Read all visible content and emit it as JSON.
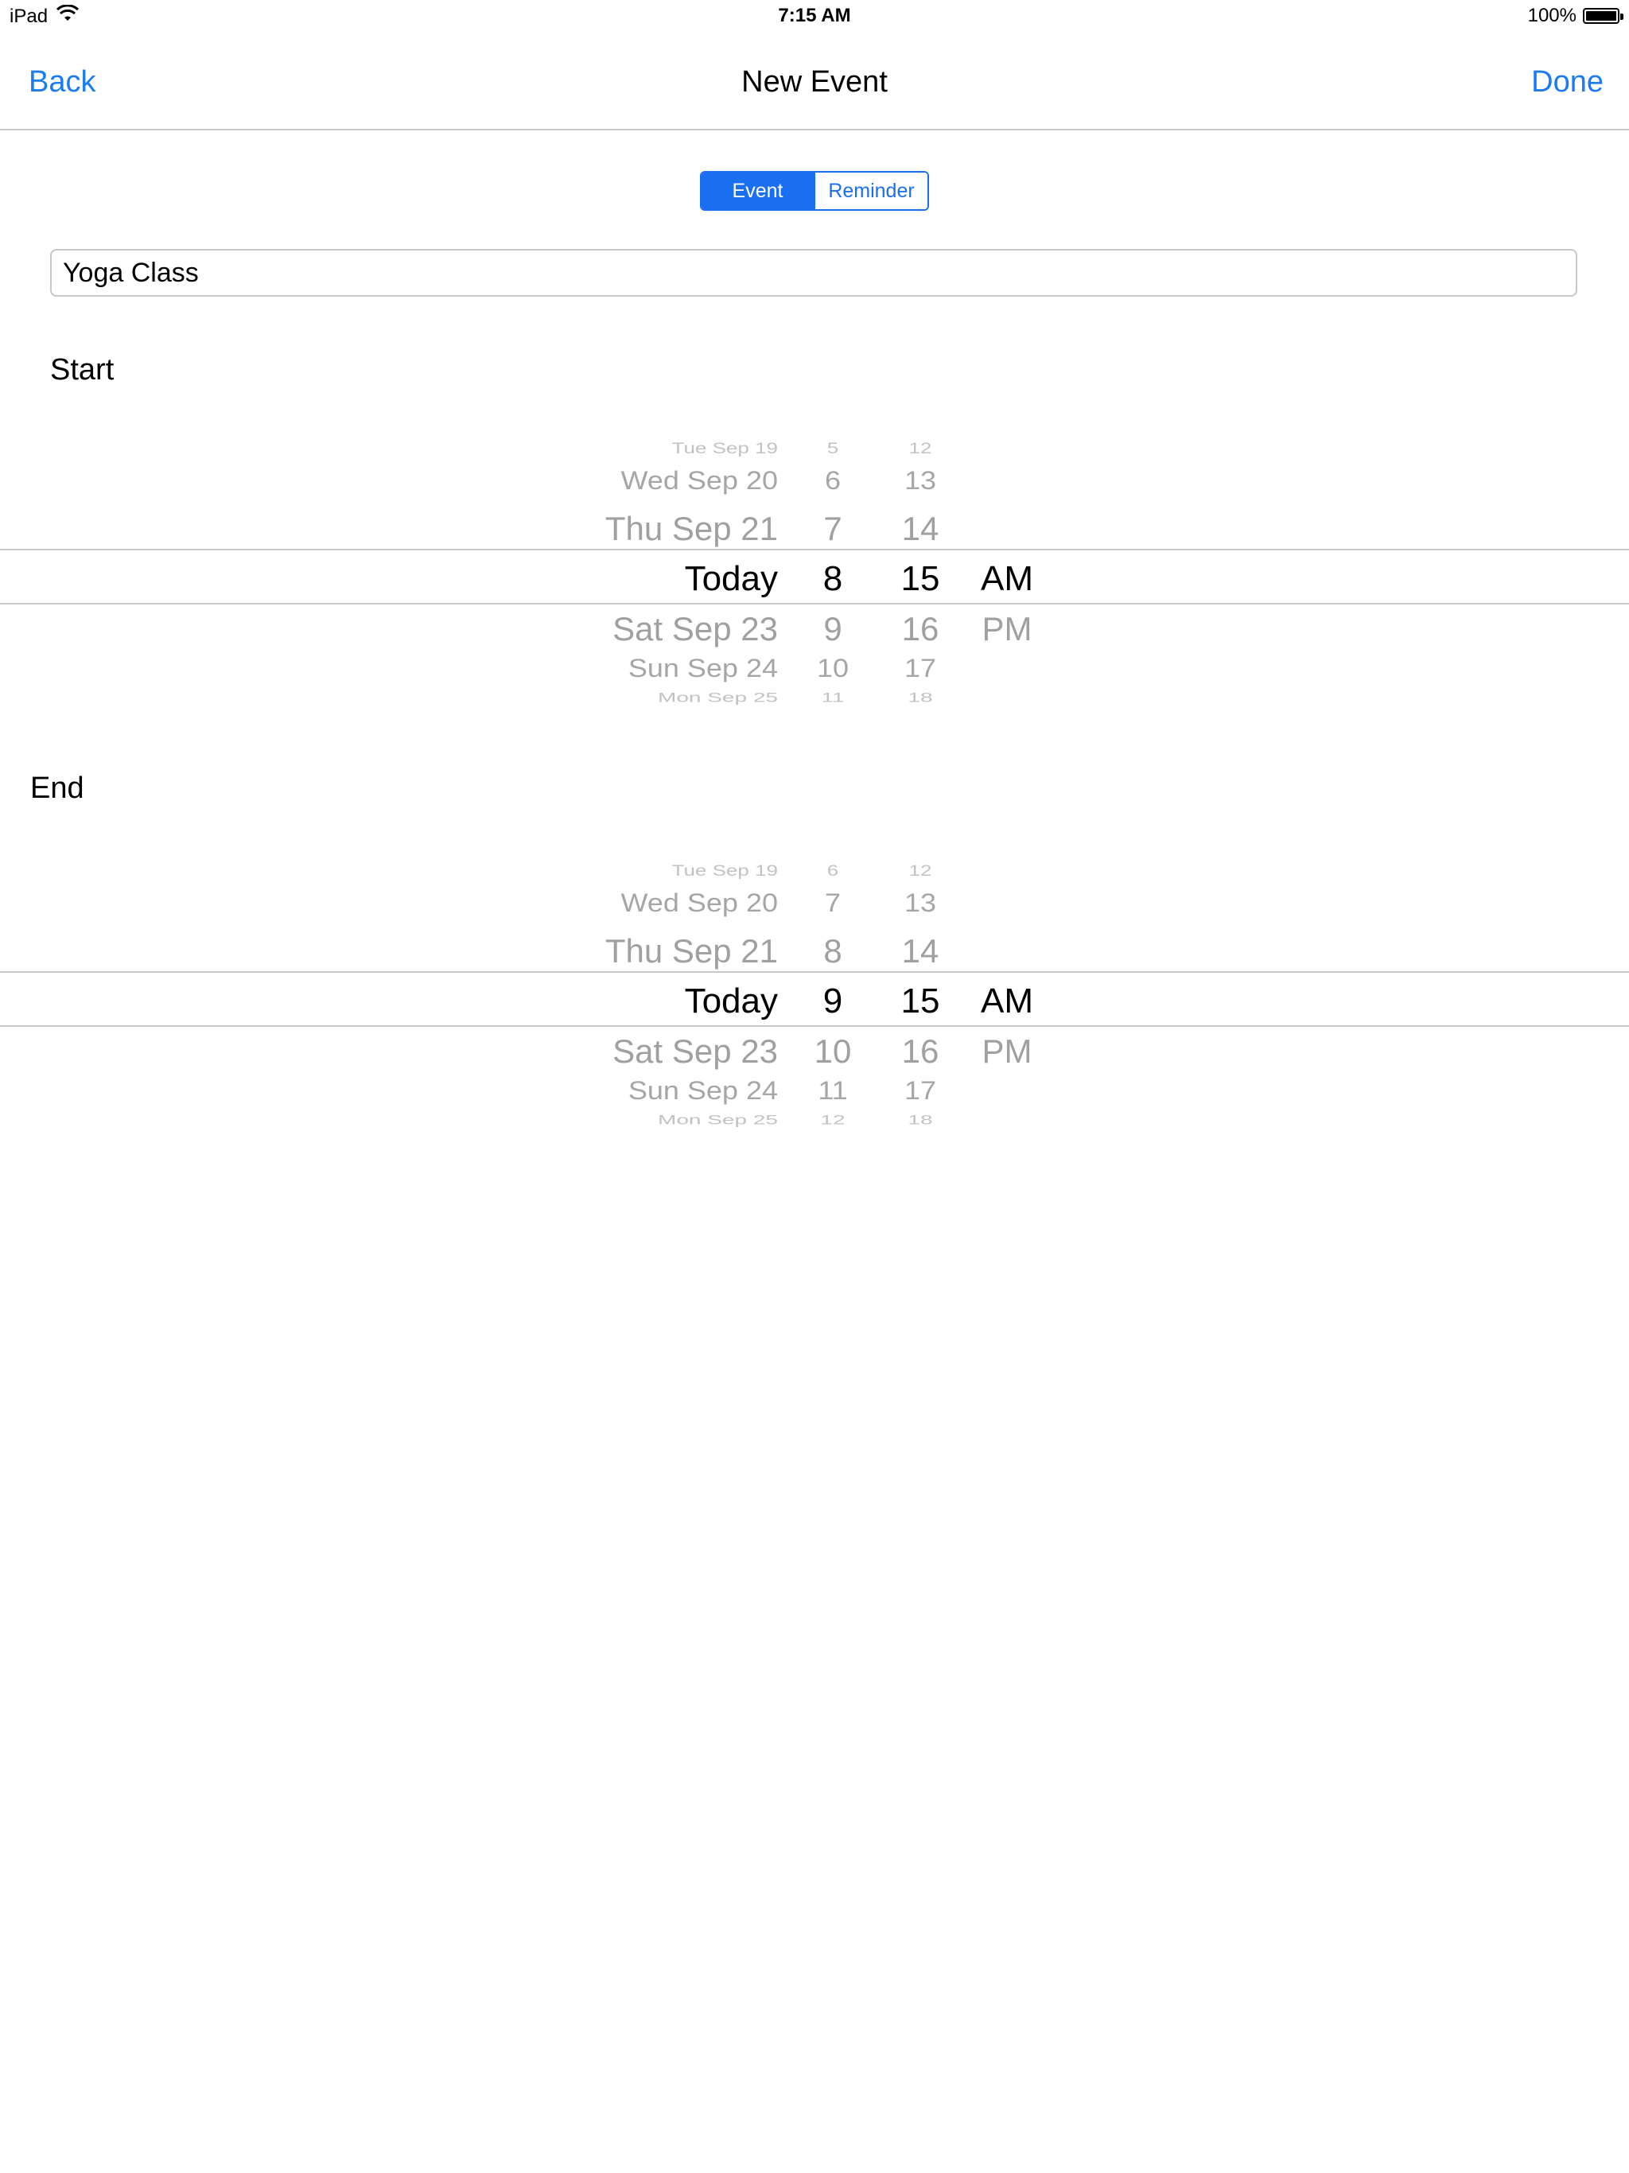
{
  "status_bar": {
    "device": "iPad",
    "time": "7:15 AM",
    "battery": "100%"
  },
  "nav": {
    "back": "Back",
    "title": "New Event",
    "done": "Done"
  },
  "segmented": {
    "event": "Event",
    "reminder": "Reminder"
  },
  "title_field": {
    "value": "Yoga Class"
  },
  "start": {
    "label": "Start",
    "dates": [
      "Tue Sep 19",
      "Wed Sep 20",
      "Thu Sep 21",
      "Today",
      "Sat Sep 23",
      "Sun Sep 24",
      "Mon Sep 25"
    ],
    "hours": [
      "5",
      "6",
      "7",
      "8",
      "9",
      "10",
      "11"
    ],
    "minutes": [
      "12",
      "13",
      "14",
      "15",
      "16",
      "17",
      "18"
    ],
    "ampm": [
      "AM",
      "PM"
    ]
  },
  "end": {
    "label": "End",
    "dates": [
      "Tue Sep 19",
      "Wed Sep 20",
      "Thu Sep 21",
      "Today",
      "Sat Sep 23",
      "Sun Sep 24",
      "Mon Sep 25"
    ],
    "hours": [
      "6",
      "7",
      "8",
      "9",
      "10",
      "11",
      "12"
    ],
    "minutes": [
      "12",
      "13",
      "14",
      "15",
      "16",
      "17",
      "18"
    ],
    "ampm": [
      "AM",
      "PM"
    ]
  }
}
